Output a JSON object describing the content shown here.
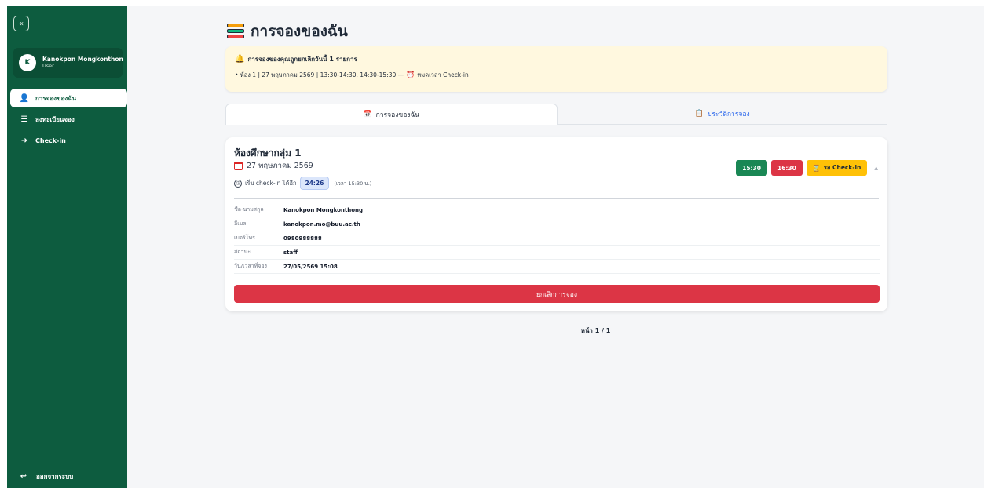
{
  "sidebar": {
    "collapse_icon": "«",
    "user": {
      "initial": "K",
      "name": "Kanokpon Mongkonthon",
      "role": "User"
    },
    "items": [
      {
        "label": "การจองของฉัน",
        "icon": "person-icon",
        "active": true
      },
      {
        "label": "ลงทะเบียนจอง",
        "icon": "layers-icon",
        "active": false
      },
      {
        "label": "Check-in",
        "icon": "login-arrow-icon",
        "active": false
      }
    ],
    "logout_label": "ออกจากระบบ"
  },
  "main": {
    "title": "การจองของฉัน",
    "alert": {
      "heading": "การจองของคุณถูกยกเลิกวันนี้ 1 รายการ",
      "line_prefix": "• ห้อง 1 | 27 พฤษภาคม 2569 | 13:30-14:30, 14:30-15:30 —",
      "line_suffix": "หมดเวลา Check-in"
    },
    "tabs": [
      {
        "label": "การจองของฉัน",
        "icon": "calendar-icon",
        "active": true
      },
      {
        "label": "ประวัติการจอง",
        "icon": "clipboard-icon",
        "active": false
      }
    ],
    "booking": {
      "room": "ห้องศึกษากลุ่ม 1",
      "date": "27 พฤษภาคม 2569",
      "checkin_prefix": "เริ่ม check-in ได้อีก",
      "countdown": "24:26",
      "checkin_note": "(เวลา 15:30 น.)",
      "start_time": "15:30",
      "end_time": "16:30",
      "status": "รอ Check-in",
      "details": [
        {
          "label": "ชื่อ-นามสกุล",
          "value": "Kanokpon Mongkonthong"
        },
        {
          "label": "อีเมล",
          "value": "kanokpon.mo@buu.ac.th"
        },
        {
          "label": "เบอร์โทร",
          "value": "0980988888"
        },
        {
          "label": "สถานะ",
          "value": "staff"
        },
        {
          "label": "วัน/เวลาที่จอง",
          "value": "27/05/2569 15:08"
        }
      ],
      "cancel_label": "ยกเลิกการจอง"
    },
    "pagination": "หน้า 1 / 1"
  },
  "colors": {
    "sidebar": "#0d5c3f",
    "success": "#198754",
    "danger": "#dc3545",
    "warning": "#ffc107",
    "alert_bg": "#fff8df",
    "link": "#2563eb"
  }
}
